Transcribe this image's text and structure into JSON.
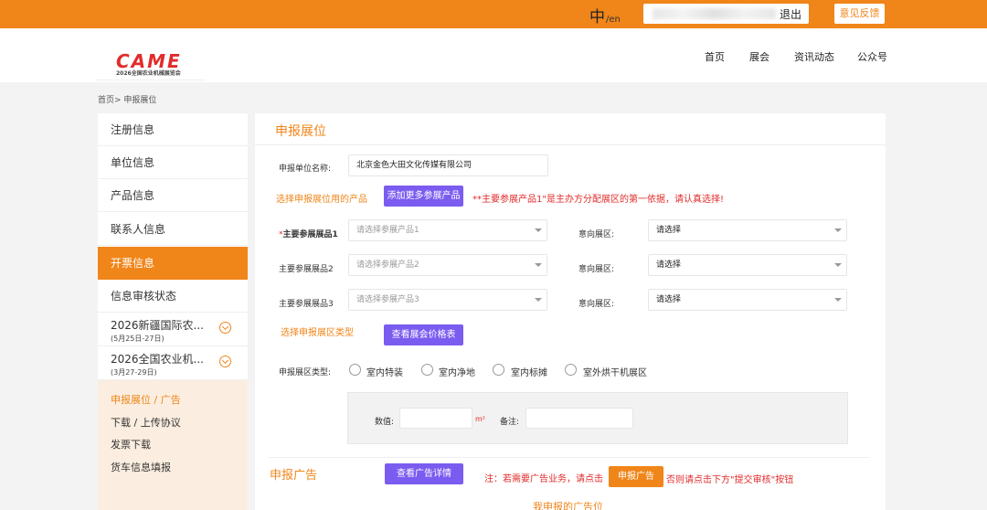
{
  "topbar": {
    "lang_zh": "中",
    "lang_en": "/en",
    "logout": "退出",
    "feedback": "意见反馈"
  },
  "header": {
    "logo_mark": "CAME",
    "logo_sub": "2026全国农业机械展览会",
    "nav": [
      "首页",
      "展会",
      "资讯动态",
      "公众号"
    ]
  },
  "breadcrumb": "首页> 申报展位",
  "sidebar": {
    "items": [
      "注册信息",
      "单位信息",
      "产品信息",
      "联系人信息",
      "开票信息",
      "信息审核状态"
    ],
    "expos": [
      {
        "title": "2026新疆国际农...",
        "date": "(5月25日-27日)"
      },
      {
        "title": "2026全国农业机...",
        "date": "(3月27-29日)"
      }
    ],
    "sub": [
      "申报展位 / 广告",
      "下载 / 上传协议",
      "发票下载",
      "货车信息填报"
    ]
  },
  "main": {
    "title": "申报展位",
    "unit_label": "申报单位名称:",
    "unit_value": "北京金色大田文化传媒有限公司",
    "choose_products": "选择申报展位用的产品",
    "add_more_btn": "添加更多参展产品",
    "note_red": "**主要参展产品1\"是主办方分配展区的第一依据，请认真选择!",
    "product_rows": [
      {
        "label": "主要参展展品1",
        "required": true,
        "placeholder": "请选择参展产品1",
        "area_label": "意向展区:",
        "area_value": "请选择"
      },
      {
        "label": "主要参展展品2",
        "required": false,
        "placeholder": "请选择参展产品2",
        "area_label": "意向展区:",
        "area_value": "请选择"
      },
      {
        "label": "主要参展展品3",
        "required": false,
        "placeholder": "请选择参展产品3",
        "area_label": "意向展区:",
        "area_value": "请选择"
      }
    ],
    "choose_area_type": "选择申报展区类型",
    "price_btn": "查看展会价格表",
    "area_type_label": "申报展区类型:",
    "area_types": [
      "室内特装",
      "室内净地",
      "室内标摊",
      "室外烘干机展区"
    ],
    "value_label": "数值:",
    "unit_m2": "m²",
    "remark_label": "备注:",
    "ad_title": "申报广告",
    "ad_detail_btn": "查看广告详情",
    "ad_note_prefix": "注：若需要广告业务，请点击",
    "ad_btn": "申报广告",
    "ad_note_suffix": "否则请点击下方\"提交审核\"按钮",
    "my_ads": "我申报的广告位"
  }
}
